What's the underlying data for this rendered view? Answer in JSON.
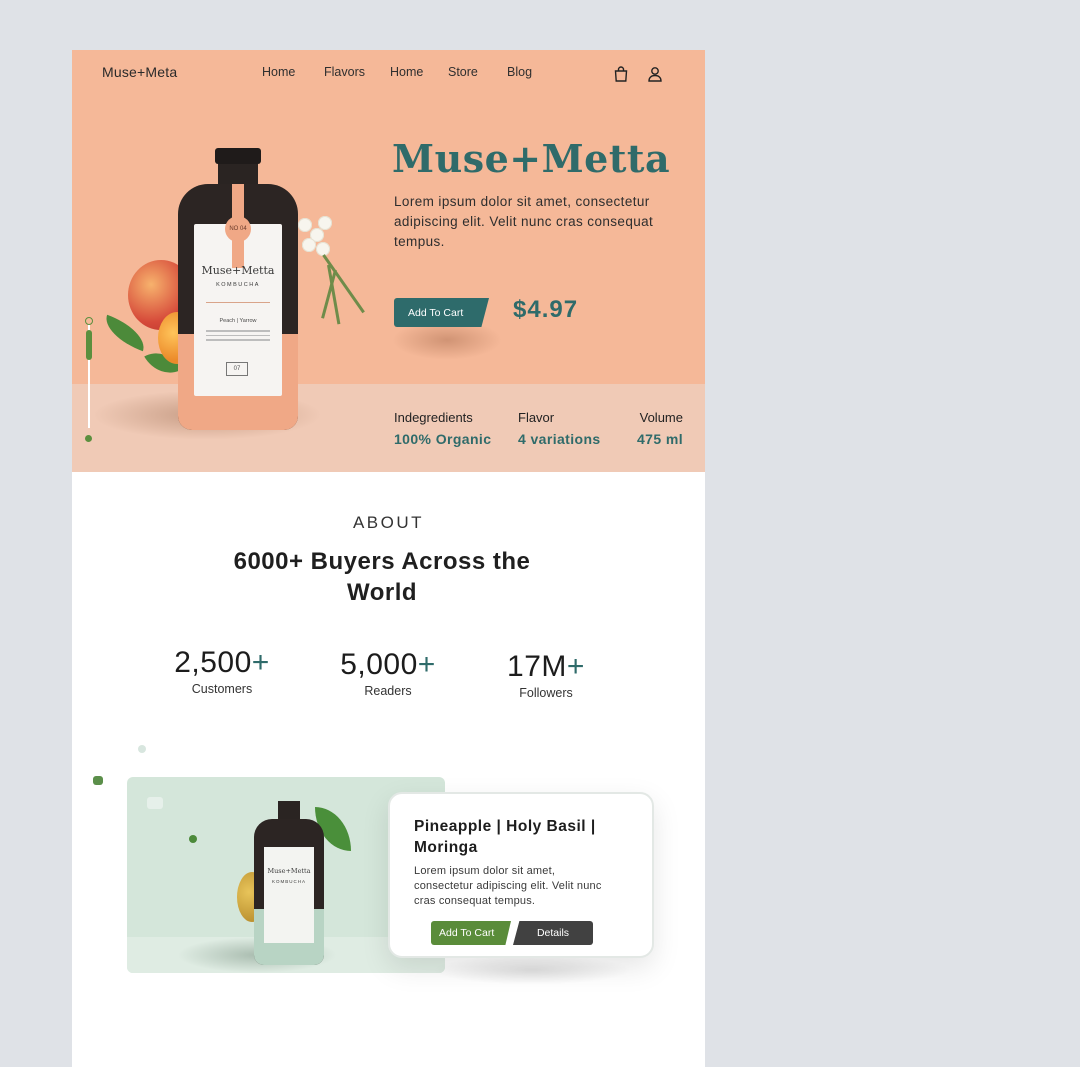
{
  "nav": {
    "logo": "Muse+Meta",
    "links": [
      "Home",
      "Flavors",
      "Home",
      "Store",
      "Blog"
    ],
    "cart_icon": "shopping-bag-icon",
    "account_icon": "user-icon"
  },
  "hero": {
    "title": "Muse+Metta",
    "description": "Lorem ipsum dolor sit amet, consectetur adipiscing elit. Velit nunc cras consequat tempus.",
    "add_to_cart": "Add To Cart",
    "price": "$4.97",
    "bottle_label": {
      "name": "Muse+Metta",
      "sub": "KOMBUCHA",
      "badge": "NO 04",
      "flavor": "Peach | Yarrow",
      "batch": "07"
    },
    "specs": [
      {
        "label": "Indegredients",
        "value": "100% Organic"
      },
      {
        "label": "Flavor",
        "value": "4 variations"
      },
      {
        "label": "Volume",
        "value": "475 ml"
      }
    ]
  },
  "about": {
    "kicker": "ABOUT",
    "title": "6000+ Buyers Across the World",
    "stats": [
      {
        "number": "2,500",
        "suffix": "+",
        "caption": "Customers"
      },
      {
        "number": "5,000",
        "suffix": "+",
        "caption": "Readers"
      },
      {
        "number": "17M",
        "suffix": "+",
        "caption": "Followers"
      }
    ]
  },
  "product": {
    "title": "Pineapple | Holy Basil | Moringa",
    "description": "Lorem ipsum dolor sit amet, consectetur adipiscing elit. Velit nunc cras consequat tempus.",
    "add_to_cart": "Add To Cart",
    "details": "Details",
    "bottle_name": "Muse+Metta",
    "bottle_sub": "KOMBUCHA"
  },
  "colors": {
    "hero_bg": "#f5b898",
    "hero_band": "#f0cab6",
    "teal": "#2f6b6a",
    "green": "#5a8c3a",
    "product_bg": "#d4e6da",
    "dark_button": "#414141"
  }
}
